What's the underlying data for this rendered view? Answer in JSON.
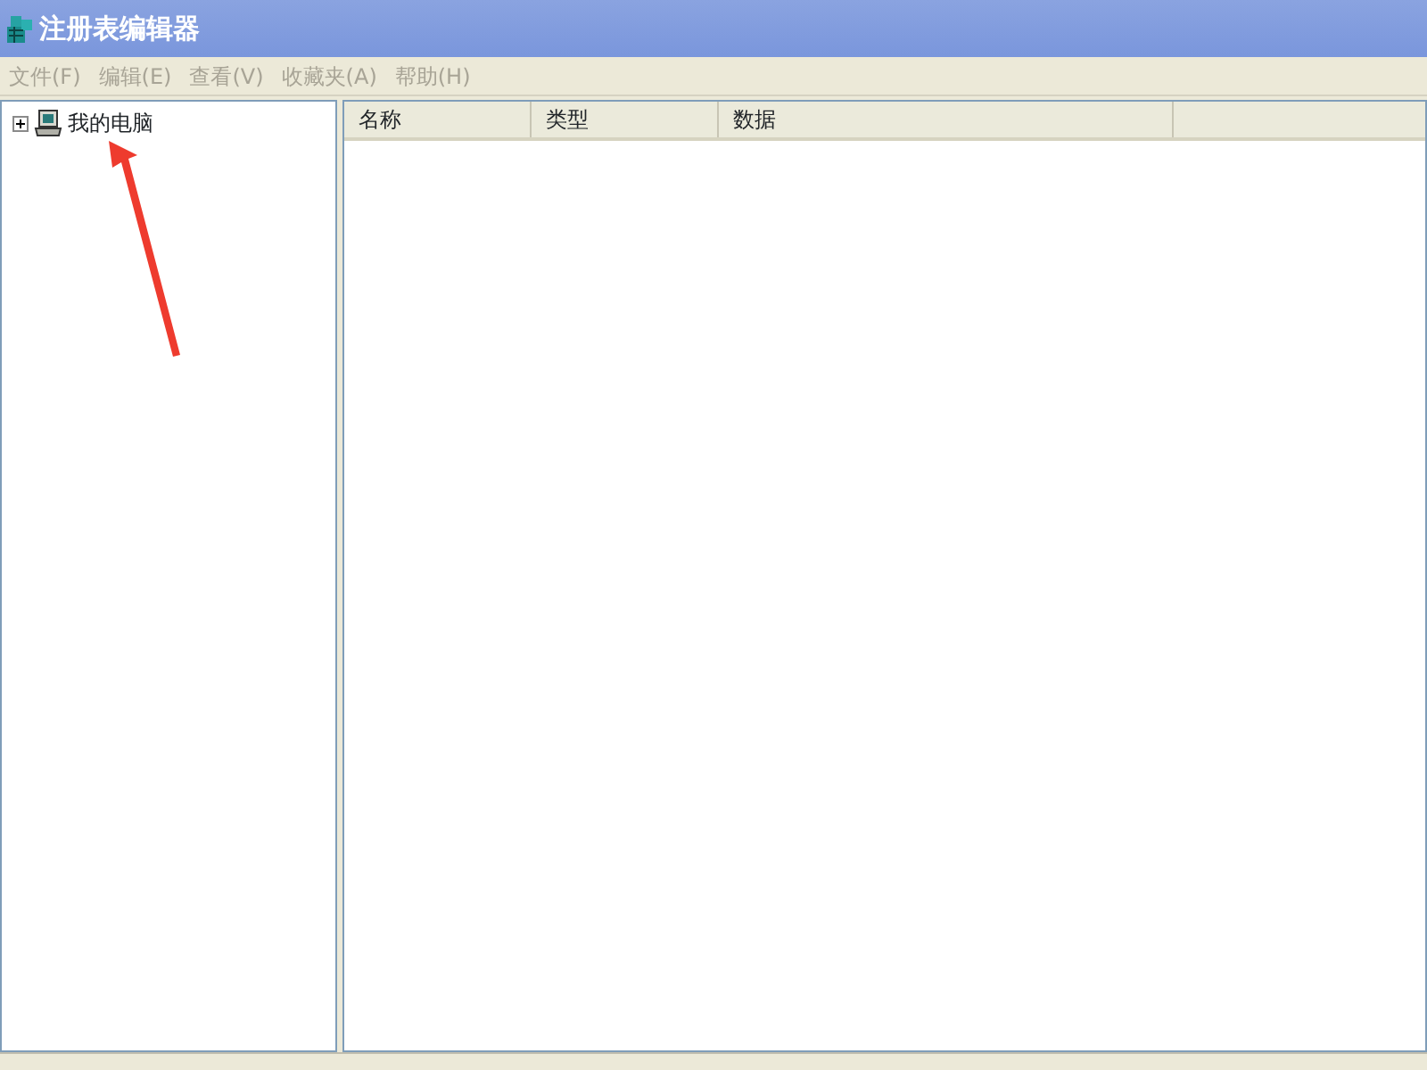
{
  "window": {
    "title": "注册表编辑器"
  },
  "menu": [
    {
      "label": "文件(F)",
      "disabled": true
    },
    {
      "label": "编辑(E)",
      "disabled": true
    },
    {
      "label": "查看(V)",
      "disabled": true
    },
    {
      "label": "收藏夹(A)",
      "disabled": true
    },
    {
      "label": "帮助(H)",
      "disabled": true
    }
  ],
  "tree": [
    {
      "label": "我的电脑",
      "expanded": false
    }
  ],
  "table": {
    "columns": [
      "名称",
      "类型",
      "数据"
    ]
  }
}
